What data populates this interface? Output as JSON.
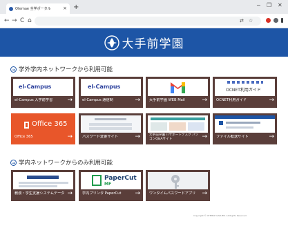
{
  "browser": {
    "tab_title": "Otemae 全学ポータル",
    "tab_close_glyph": "×",
    "new_tab_glyph": "+",
    "back_glyph": "←",
    "forward_glyph": "→",
    "reload_glyph": "C",
    "home_glyph": "⌂",
    "minimize_glyph": "−",
    "maximize_glyph": "❐",
    "close_glyph": "✕"
  },
  "header": {
    "title": "大手前学園",
    "bg": "#1d55a6"
  },
  "sections": [
    {
      "title": "学外学内ネットワークから利用可能",
      "tiles": [
        {
          "label": "el-Campus 入学前学習",
          "thumb": "el-Campus",
          "arrow": "→"
        },
        {
          "label": "el-Campus 通信制",
          "thumb": "el-Campus",
          "arrow": "→"
        },
        {
          "label": "大手前学園 WEB Mail",
          "thumb": "gmail",
          "arrow": "→"
        },
        {
          "label": "OCNET利用ガイド",
          "thumb": "OCNET利用ガイド",
          "arrow": "→"
        },
        {
          "label": "Office 365",
          "thumb": "Office 365",
          "arrow": "→"
        },
        {
          "label": "パスワード変更サイト",
          "thumb": "password",
          "arrow": "→"
        },
        {
          "label": "大手前学園 ITサポートデスク パソコンQ&Aサイト",
          "thumb": "it-support",
          "arrow": "→"
        },
        {
          "label": "ファイル転送サイト",
          "thumb": "file-transfer",
          "arrow": "→"
        }
      ]
    },
    {
      "title": "学内ネットワークからのみ利用可能",
      "tiles": [
        {
          "label": "教務・学生支援システムデータ",
          "thumb": "universal-passport",
          "arrow": "→"
        },
        {
          "label": "学内プリンタ PaperCut",
          "thumb": "PaperCut",
          "arrow": "→"
        },
        {
          "label": "ワンタイムパスワードアプリ",
          "thumb": "key",
          "arrow": "→"
        }
      ]
    }
  ],
  "thumb_texts": {
    "elcampus": "el-Campus",
    "ocnet": "OCNET利用ガイド",
    "office": "Office 365",
    "papercut": "PaperCut",
    "papercut_sub": "MF"
  },
  "footer": "Copyright © OTEMAE GAKUEN. All Rights Reserved."
}
